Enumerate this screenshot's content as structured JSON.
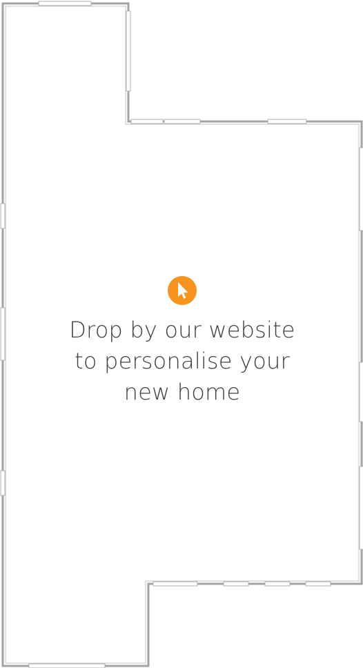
{
  "accent_color": "#F7931E",
  "wall_color": "#A3A3A3",
  "text_color": "#3F3F3F",
  "cursor_icon": "pointer-cursor-icon",
  "message": {
    "line1": "Drop by our website",
    "line2": "to personalise your",
    "line3": "new home"
  }
}
